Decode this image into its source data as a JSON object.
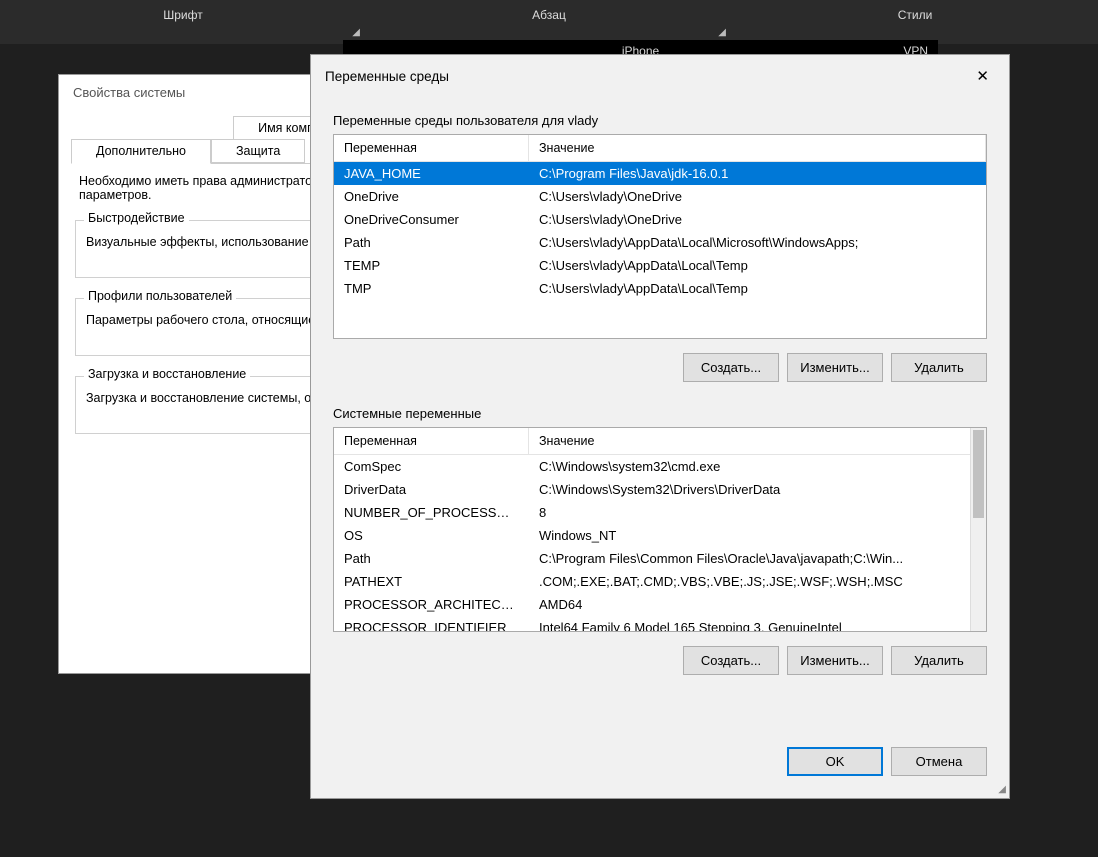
{
  "ribbon": {
    "group1": "Шрифт",
    "group2": "Абзац",
    "group3": "Стили"
  },
  "blackstrip": {
    "iphone": "iPhone",
    "vpn": "VPN"
  },
  "sysprops": {
    "title": "Свойства системы",
    "tab_computer_name": "Имя компьютера",
    "tab_advanced": "Дополнительно",
    "tab_protection": "Защита",
    "note": "Необходимо иметь права администратора для изменения перечисленных параметров.",
    "perf_legend": "Быстродействие",
    "perf_text": "Визуальные эффекты, использование процессора, виртуальной памяти",
    "profiles_legend": "Профили пользователей",
    "profiles_text": "Параметры рабочего стола, относящиеся ко входу в систему",
    "boot_legend": "Загрузка и восстановление",
    "boot_text": "Загрузка и восстановление системы, отладочная информация"
  },
  "env": {
    "title": "Переменные среды",
    "user_group": "Переменные среды пользователя для vlady",
    "sys_group": "Системные переменные",
    "col_var": "Переменная",
    "col_val": "Значение",
    "buttons": {
      "create": "Создать...",
      "edit": "Изменить...",
      "delete": "Удалить",
      "ok": "OK",
      "cancel": "Отмена"
    },
    "user_vars": [
      {
        "name": "JAVA_HOME",
        "value": "C:\\Program Files\\Java\\jdk-16.0.1",
        "selected": true
      },
      {
        "name": "OneDrive",
        "value": "C:\\Users\\vlady\\OneDrive"
      },
      {
        "name": "OneDriveConsumer",
        "value": "C:\\Users\\vlady\\OneDrive"
      },
      {
        "name": "Path",
        "value": "C:\\Users\\vlady\\AppData\\Local\\Microsoft\\WindowsApps;"
      },
      {
        "name": "TEMP",
        "value": "C:\\Users\\vlady\\AppData\\Local\\Temp"
      },
      {
        "name": "TMP",
        "value": "C:\\Users\\vlady\\AppData\\Local\\Temp"
      }
    ],
    "sys_vars": [
      {
        "name": "ComSpec",
        "value": "C:\\Windows\\system32\\cmd.exe"
      },
      {
        "name": "DriverData",
        "value": "C:\\Windows\\System32\\Drivers\\DriverData"
      },
      {
        "name": "NUMBER_OF_PROCESSORS",
        "value": "8"
      },
      {
        "name": "OS",
        "value": "Windows_NT"
      },
      {
        "name": "Path",
        "value": "C:\\Program Files\\Common Files\\Oracle\\Java\\javapath;C:\\Win..."
      },
      {
        "name": "PATHEXT",
        "value": ".COM;.EXE;.BAT;.CMD;.VBS;.VBE;.JS;.JSE;.WSF;.WSH;.MSC"
      },
      {
        "name": "PROCESSOR_ARCHITECTU...",
        "value": "AMD64"
      },
      {
        "name": "PROCESSOR_IDENTIFIER",
        "value": "Intel64 Family 6 Model 165 Stepping 3, GenuineIntel"
      }
    ]
  }
}
